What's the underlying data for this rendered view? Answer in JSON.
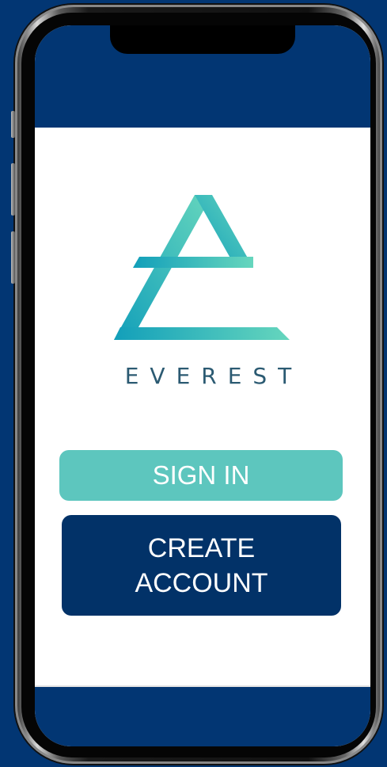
{
  "app": {
    "brand_name": "EVEREST",
    "logo": "everest-mountain-e-logo"
  },
  "actions": {
    "sign_in_label": "SIGN IN",
    "create_account_label": "CREATE\nACCOUNT"
  },
  "colors": {
    "page_background": "#023673",
    "brand_navy": "#023268",
    "accent_teal": "#5dc6be",
    "logo_gradient_start": "#129fba",
    "logo_gradient_end": "#66d6bd",
    "brand_text": "#2b5a72",
    "screen_background": "#ffffff"
  }
}
